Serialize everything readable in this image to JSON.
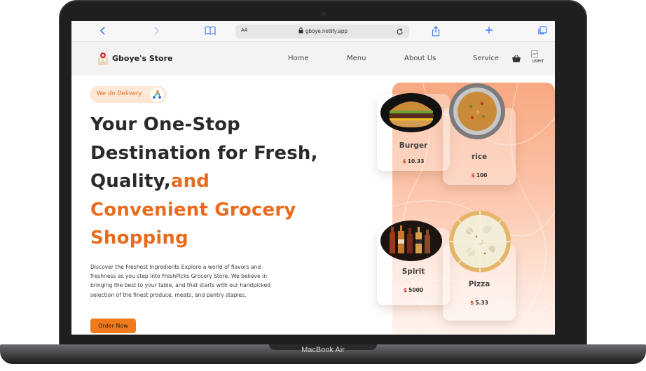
{
  "device": {
    "label": "MacBook Air"
  },
  "browser": {
    "aa_label": "AA",
    "url": "gboye.netlify.app",
    "icons": [
      "back-icon",
      "forward-icon",
      "bookmarks-icon",
      "lock-icon",
      "reload-icon",
      "share-icon",
      "new-tab-icon",
      "tabs-icon"
    ]
  },
  "nav": {
    "brand": "Gboye's Store",
    "links": [
      "Home",
      "Menu",
      "About Us",
      "Service"
    ],
    "avatar_alt": "userr"
  },
  "hero": {
    "badge": "We do Delivery",
    "title_part1": "Your One-Stop Destination for Fresh, Quality,",
    "title_part2": "and Convenient Grocery Shopping",
    "description": "Discover the Freshest Ingredients Explore a world of flavors and freshness as you step into FreshPicks Grocery Store. We believe in bringing the best to your table, and that starts with our handpicked selection of the finest produce, meats, and pantry staples.",
    "cta": "Order Now"
  },
  "products": [
    {
      "name": "Burger",
      "currency": "$",
      "price": "10.33"
    },
    {
      "name": "rice",
      "currency": "$",
      "price": "100"
    },
    {
      "name": "Spirit",
      "currency": "$",
      "price": "5000"
    },
    {
      "name": "Pizza",
      "currency": "$",
      "price": "5.33"
    }
  ],
  "colors": {
    "accent": "#ea6a1e",
    "button": "#f07b1f",
    "panel": "#f8a880",
    "price_currency": "#d23a2a"
  }
}
